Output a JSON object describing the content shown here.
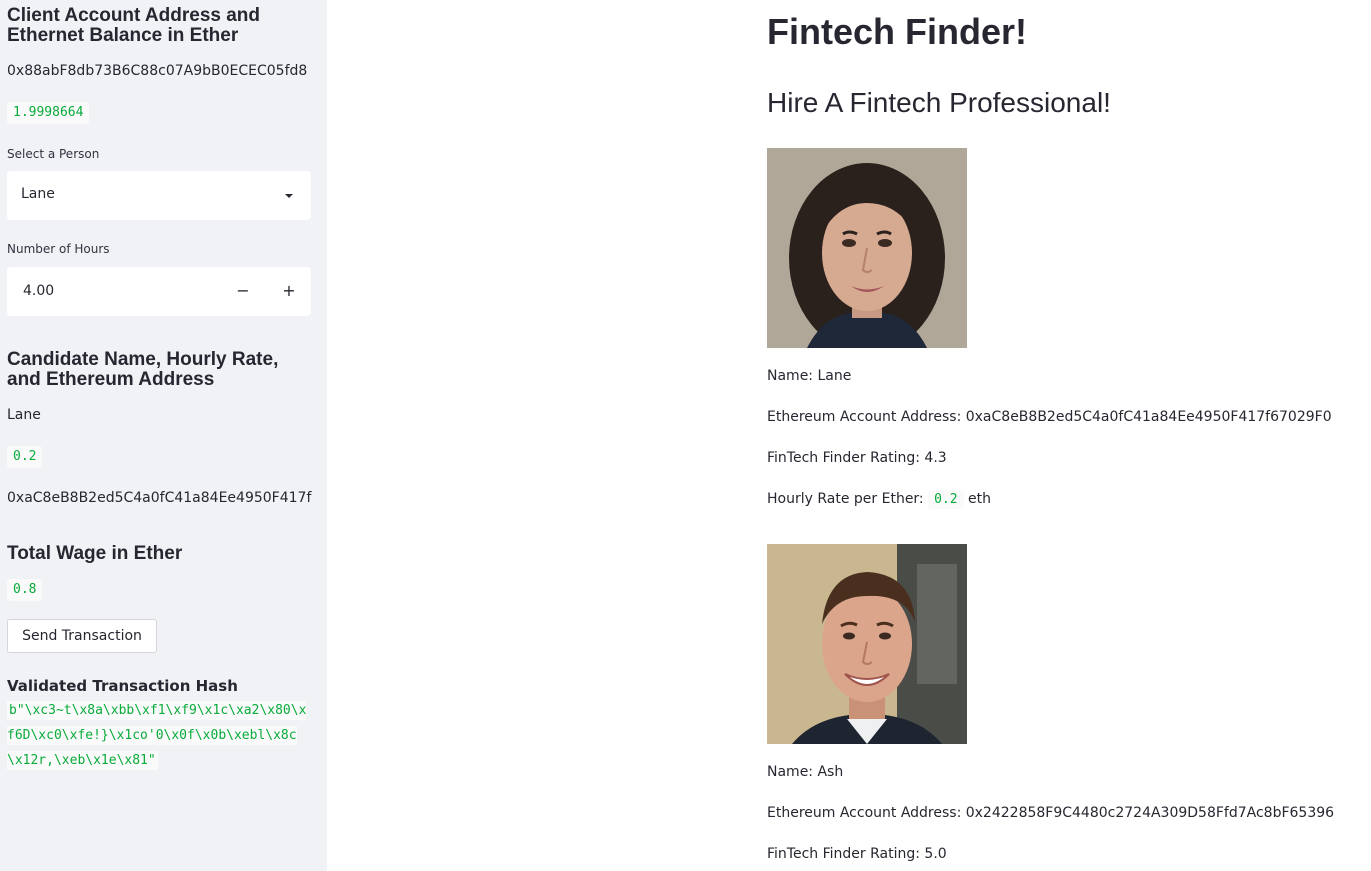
{
  "sidebar": {
    "account_heading": "Client Account Address and Ethernet Balance in Ether",
    "account_address": "0x88abF8db73B6C88c07A9bB0ECEC05fd8",
    "balance": "1.9998664",
    "select_label": "Select a Person",
    "selected_person": "Lane",
    "hours_label": "Number of Hours",
    "hours_value": "4.00",
    "minus": "−",
    "plus": "+",
    "candidate_heading": "Candidate Name, Hourly Rate, and Ethereum Address",
    "candidate_name": "Lane",
    "candidate_rate": "0.2",
    "candidate_address": "0xaC8eB8B2ed5C4a0fC41a84Ee4950F417f",
    "wage_heading": "Total Wage in Ether",
    "wage_value": "0.8",
    "send_button": "Send Transaction",
    "hash_label": "Validated Transaction Hash",
    "hash_value": "b\"\\xc3~t\\x8a\\xbb\\xf1\\xf9\\x1c\\xa2\\x80\\xf6D\\xc0\\xfe!}\\x1co'0\\x0f\\x0b\\xebl\\x8c\\x12r,\\xeb\\x1e\\x81\""
  },
  "main": {
    "title": "Fintech Finder!",
    "subtitle": "Hire A Fintech Professional!",
    "candidates": [
      {
        "name_line": "Name: Lane",
        "address_line": "Ethereum Account Address: 0xaC8eB8B2ed5C4a0fC41a84Ee4950F417f67029F0",
        "rating_line": "FinTech Finder Rating: 4.3",
        "rate_prefix": "Hourly Rate per Ether:",
        "rate_value": "0.2",
        "rate_suffix": "eth"
      },
      {
        "name_line": "Name: Ash",
        "address_line": "Ethereum Account Address: 0x2422858F9C4480c2724A309D58Ffd7Ac8bF65396",
        "rating_line": "FinTech Finder Rating: 5.0"
      }
    ]
  },
  "colors": {
    "sidebar_bg": "#f0f2f6",
    "code_green": "#09ab3b",
    "text": "#262730"
  }
}
